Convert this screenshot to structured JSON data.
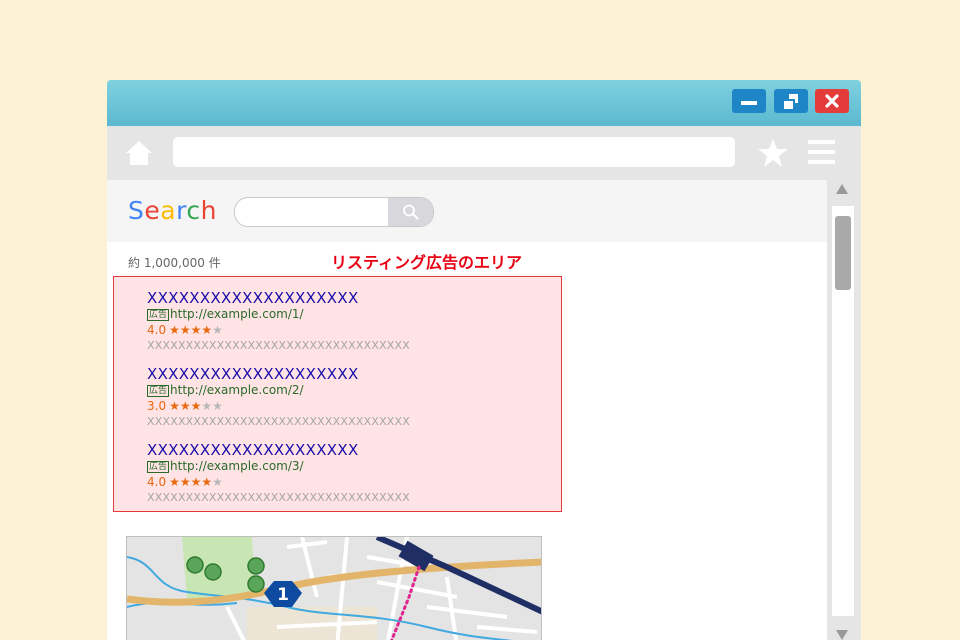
{
  "titlebar": {
    "minimize_icon": "minimize-icon",
    "maximize_icon": "restore-icon",
    "close_icon": "close-icon"
  },
  "toolbar": {
    "home_icon": "home-icon",
    "url_value": "",
    "bookmark_icon": "star-icon",
    "menu_icon": "hamburger-menu-icon"
  },
  "search": {
    "logo_letters": [
      "S",
      "e",
      "a",
      "r",
      "c",
      "h"
    ],
    "logo_colors": [
      "#4285f4",
      "#ea4335",
      "#fbbc05",
      "#4285f4",
      "#34a853",
      "#ea4335"
    ],
    "query": "",
    "button_icon": "magnifier-icon"
  },
  "results": {
    "count_text": "約 1,000,000 件",
    "ad_area_label": "リスティング広告のエリア",
    "ads": [
      {
        "title": "XXXXXXXXXXXXXXXXXXXX",
        "badge": "広告",
        "url": "http://example.com/1/",
        "rating_text": "4.0",
        "rating": 4,
        "rating_max": 5,
        "description": "XXXXXXXXXXXXXXXXXXXXXXXXXXXXXXXXXX"
      },
      {
        "title": "XXXXXXXXXXXXXXXXXXXX",
        "badge": "広告",
        "url": "http://example.com/2/",
        "rating_text": "3.0",
        "rating": 3,
        "rating_max": 5,
        "description": "XXXXXXXXXXXXXXXXXXXXXXXXXXXXXXXXXX"
      },
      {
        "title": "XXXXXXXXXXXXXXXXXXXX",
        "badge": "広告",
        "url": "http://example.com/3/",
        "rating_text": "4.0",
        "rating": 4,
        "rating_max": 5,
        "description": "XXXXXXXXXXXXXXXXXXXXXXXXXXXXXXXXXX"
      }
    ]
  },
  "map": {
    "route_number": "1"
  },
  "colors": {
    "accent_ad_border": "#e53a3a",
    "ad_label": "#e60012",
    "ad_title": "#1a0dab",
    "ad_url": "#2a6b2a",
    "rating": "#e8690f"
  }
}
